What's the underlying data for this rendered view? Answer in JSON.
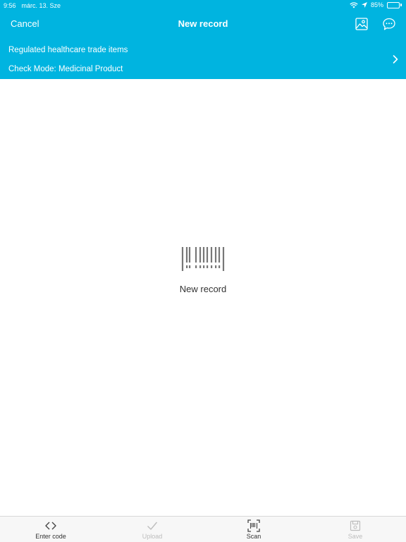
{
  "status_bar": {
    "time": "9:56",
    "date": "márc. 13. Sze",
    "battery_percent": "85%",
    "battery_level": 0.85
  },
  "nav": {
    "cancel_label": "Cancel",
    "title": "New record",
    "icons": [
      "gallery-icon",
      "chat-bubble-icon"
    ]
  },
  "info": {
    "line1": "Regulated healthcare trade items",
    "line2": "Check Mode: Medicinal Product"
  },
  "empty_state": {
    "label": "New record",
    "icon": "barcode-icon"
  },
  "tabs": [
    {
      "label": "Enter code",
      "icon": "code-brackets-icon",
      "enabled": true
    },
    {
      "label": "Upload",
      "icon": "checkmark-icon",
      "enabled": false
    },
    {
      "label": "Scan",
      "icon": "barcode-scan-icon",
      "enabled": true
    },
    {
      "label": "Save",
      "icon": "save-icon",
      "enabled": false
    }
  ],
  "colors": {
    "header_bg": "#00b4e0",
    "text_on_header": "#ffffff",
    "tab_disabled": "#bdbdbd"
  }
}
